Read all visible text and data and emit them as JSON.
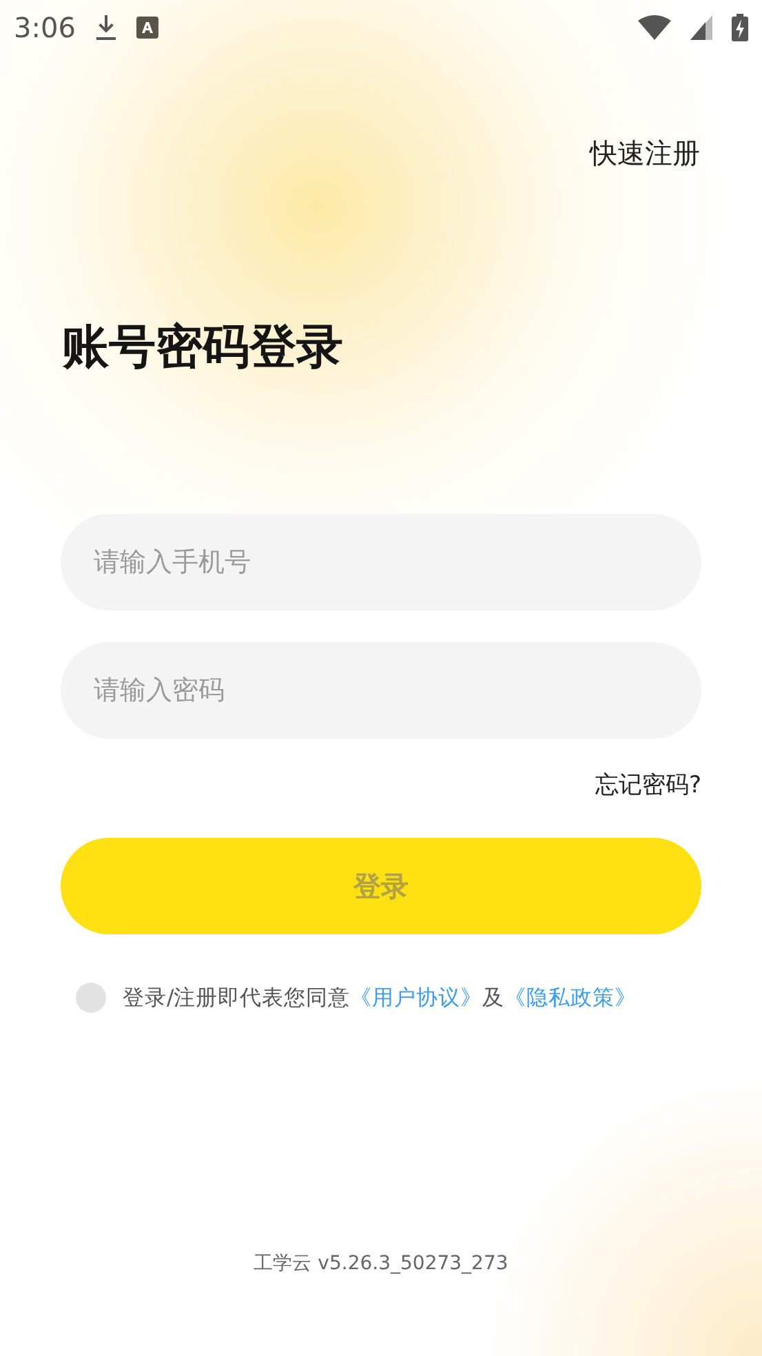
{
  "status_bar": {
    "time": "3:06"
  },
  "register_link": "快速注册",
  "title": "账号密码登录",
  "phone_field": {
    "placeholder": "请输入手机号"
  },
  "password_field": {
    "placeholder": "请输入密码"
  },
  "forgot_link": "忘记密码?",
  "login_button": {
    "label": "登录",
    "disabled": true
  },
  "agreement": {
    "checked": false,
    "text": "登录/注册即代表您同意",
    "link_1": "《用户协议》",
    "joiner": "及",
    "link_2": "《隐私政策》"
  },
  "footer": "工学云 v5.26.3_50273_273"
}
